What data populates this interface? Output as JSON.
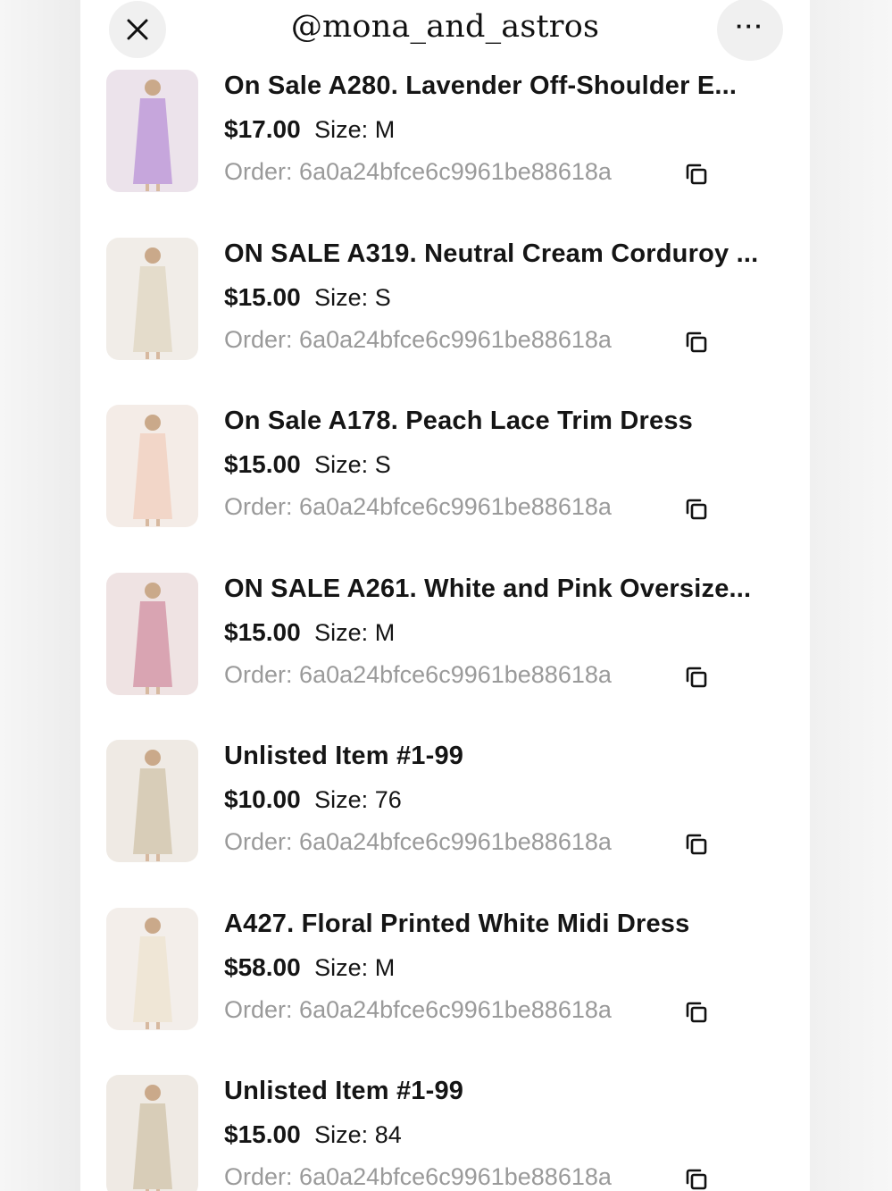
{
  "header": {
    "title": "@mona_and_astros",
    "close_icon": "close-icon",
    "more_icon": "more-horizontal-icon",
    "more_label": "···"
  },
  "items": [
    {
      "name": "On Sale A280. Lavender Off-Shoulder E...",
      "price": "$17.00",
      "size_label": "Size:",
      "size": "M",
      "order_label": "Order:",
      "order_id": "6a0a24bfce6c9961be88618a",
      "thumb_color": "#c6a6dc"
    },
    {
      "name": "ON SALE A319. Neutral Cream Corduroy ...",
      "price": "$15.00",
      "size_label": "Size:",
      "size": "S",
      "order_label": "Order:",
      "order_id": "6a0a24bfce6c9961be88618a",
      "thumb_color": "#e4dccb"
    },
    {
      "name": "On Sale A178. Peach Lace Trim Dress",
      "price": "$15.00",
      "size_label": "Size:",
      "size": "S",
      "order_label": "Order:",
      "order_id": "6a0a24bfce6c9961be88618a",
      "thumb_color": "#f2d6c8"
    },
    {
      "name": "ON SALE A261. White and Pink Oversize...",
      "price": "$15.00",
      "size_label": "Size:",
      "size": "M",
      "order_label": "Order:",
      "order_id": "6a0a24bfce6c9961be88618a",
      "thumb_color": "#d9a4b2"
    },
    {
      "name": "Unlisted Item #1-99",
      "price": "$10.00",
      "size_label": "Size:",
      "size": "76",
      "order_label": "Order:",
      "order_id": "6a0a24bfce6c9961be88618a",
      "thumb_color": "#d8cdb8"
    },
    {
      "name": "A427. Floral Printed White Midi Dress",
      "price": "$58.00",
      "size_label": "Size:",
      "size": "M",
      "order_label": "Order:",
      "order_id": "6a0a24bfce6c9961be88618a",
      "thumb_color": "#efe6d6"
    },
    {
      "name": "Unlisted Item #1-99",
      "price": "$15.00",
      "size_label": "Size:",
      "size": "84",
      "order_label": "Order:",
      "order_id": "6a0a24bfce6c9961be88618a",
      "thumb_color": "#d8cdb8"
    }
  ]
}
